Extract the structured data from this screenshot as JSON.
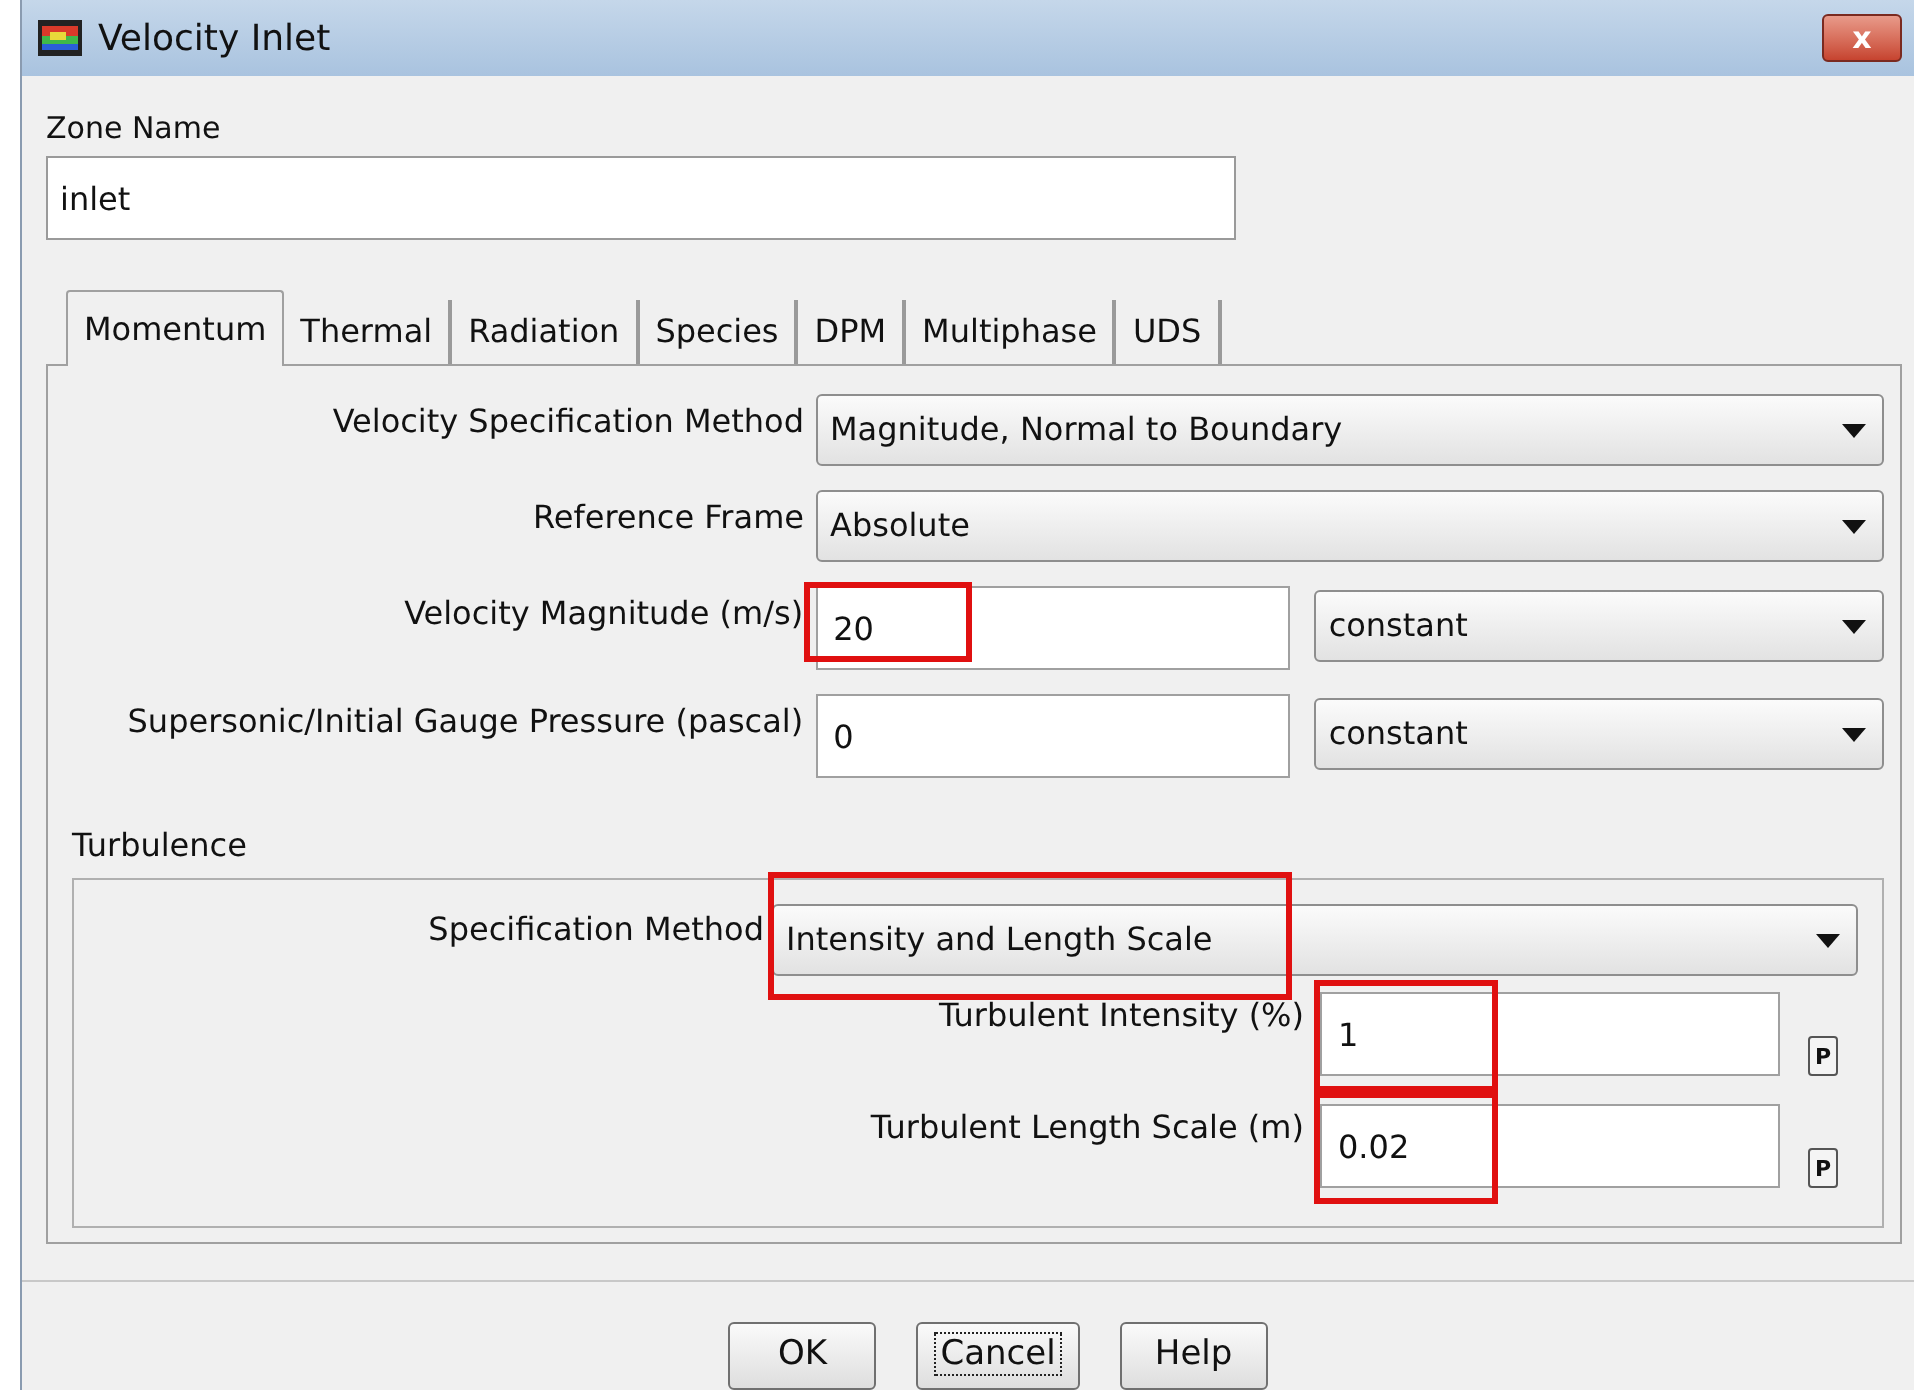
{
  "window": {
    "title": "Velocity Inlet",
    "close": "x"
  },
  "zone_name": {
    "label": "Zone Name",
    "value": "inlet"
  },
  "tabs": [
    {
      "label": "Momentum",
      "selected": true
    },
    {
      "label": "Thermal",
      "selected": false
    },
    {
      "label": "Radiation",
      "selected": false
    },
    {
      "label": "Species",
      "selected": false
    },
    {
      "label": "DPM",
      "selected": false
    },
    {
      "label": "Multiphase",
      "selected": false
    },
    {
      "label": "UDS",
      "selected": false
    }
  ],
  "momentum": {
    "rows": [
      {
        "kind": "dropdown",
        "label": "Velocity Specification Method",
        "value": "Magnitude, Normal to Boundary",
        "highlighted": false
      },
      {
        "kind": "dropdown",
        "label": "Reference Frame",
        "value": "Absolute",
        "highlighted": false
      },
      {
        "kind": "input_dropdown",
        "label": "Velocity Magnitude (m/s)",
        "value": "20",
        "option": "constant",
        "highlighted": true
      },
      {
        "kind": "input_dropdown",
        "label": "Supersonic/Initial Gauge Pressure (pascal)",
        "value": "0",
        "option": "constant",
        "highlighted": false
      }
    ]
  },
  "turbulence": {
    "title": "Turbulence",
    "rows": [
      {
        "kind": "dropdown",
        "label": "Specification Method",
        "value": "Intensity and Length Scale",
        "highlighted": true
      },
      {
        "kind": "param_input",
        "label": "Turbulent Intensity (%)",
        "value": "1",
        "button": "P",
        "highlighted": true
      },
      {
        "kind": "param_input",
        "label": "Turbulent Length Scale (m)",
        "value": "0.02",
        "button": "P",
        "highlighted": true
      }
    ]
  },
  "buttons": [
    {
      "label": "OK",
      "focused": false
    },
    {
      "label": "Cancel",
      "focused": true
    },
    {
      "label": "Help",
      "focused": false
    }
  ]
}
